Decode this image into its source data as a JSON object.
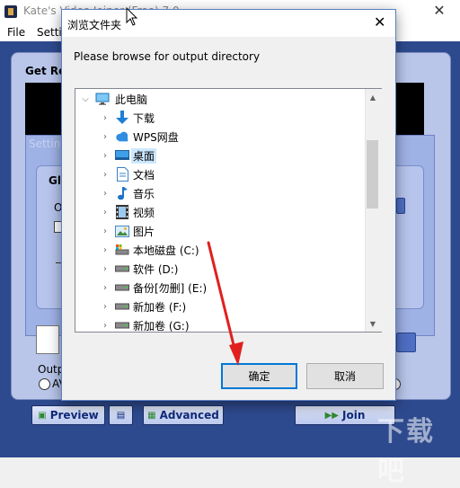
{
  "main_window": {
    "title": "Kate's Video Joiner (Free) 7.0",
    "menu": [
      "File",
      "Settin"
    ],
    "close_glyph": "✕",
    "panel_title": "Get Re",
    "settings_title": "Setting",
    "group_label": "Gl",
    "option_label": "O",
    "output_label": "Outpu",
    "radio_label": "AV",
    "toolbar": {
      "preview_label": "Preview",
      "advanced_label": "Advanced",
      "join_label": "Join"
    },
    "watermark": "下载吧"
  },
  "dialog": {
    "title": "浏览文件夹",
    "close_glyph": "✕",
    "instruction": "Please browse for output directory",
    "tree": [
      {
        "label": "此电脑",
        "icon": "computer-icon",
        "level": 0,
        "expanded": true
      },
      {
        "label": "下载",
        "icon": "download-icon",
        "level": 1
      },
      {
        "label": "WPS网盘",
        "icon": "cloud-icon",
        "level": 1
      },
      {
        "label": "桌面",
        "icon": "desktop-icon",
        "level": 1,
        "selected": true
      },
      {
        "label": "文档",
        "icon": "document-icon",
        "level": 1
      },
      {
        "label": "音乐",
        "icon": "music-icon",
        "level": 1
      },
      {
        "label": "视频",
        "icon": "video-icon",
        "level": 1
      },
      {
        "label": "图片",
        "icon": "picture-icon",
        "level": 1
      },
      {
        "label": "本地磁盘 (C:)",
        "icon": "system-drive-icon",
        "level": 1
      },
      {
        "label": "软件 (D:)",
        "icon": "drive-icon",
        "level": 1
      },
      {
        "label": "备份[勿删] (E:)",
        "icon": "drive-icon",
        "level": 1
      },
      {
        "label": "新加卷 (F:)",
        "icon": "drive-icon",
        "level": 1
      },
      {
        "label": "新加卷 (G:)",
        "icon": "drive-icon",
        "level": 1
      }
    ],
    "ok_label": "确定",
    "cancel_label": "取消"
  },
  "colors": {
    "accent": "#0078d7",
    "selection": "#cce8ff",
    "annotation_arrow": "#e0201e",
    "app_background": "#2e4a8e"
  }
}
